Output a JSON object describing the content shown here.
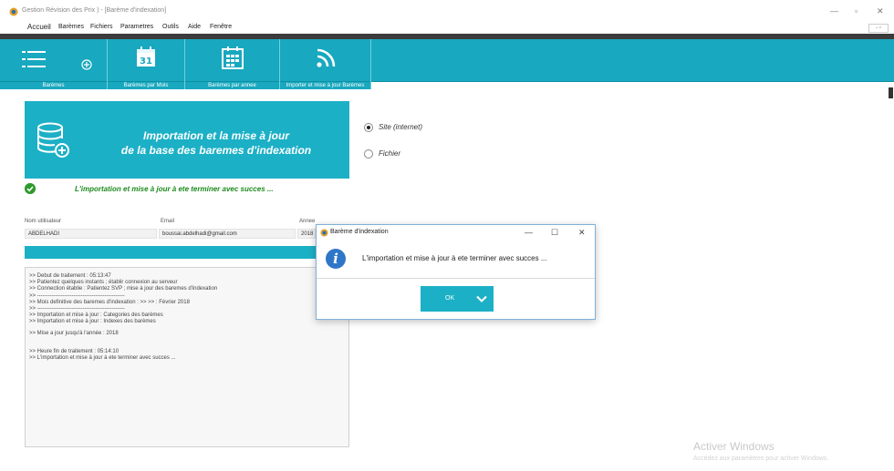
{
  "window": {
    "title": "Gestion Révision des Prix  ) - [Barème d'indexation]",
    "controls": [
      "—",
      "▫",
      "✕"
    ],
    "mdi_controls": "- ▫"
  },
  "menu": [
    "Accueil",
    "Barèmes",
    "Fichiers",
    "Parametres",
    "Outils",
    "Aide",
    "Fenêtre"
  ],
  "toolbar": {
    "calendar_number": "31",
    "buttons": [
      {
        "label": "Barèmes",
        "icon": "list-add-icon"
      },
      {
        "label": "Barèmes par Mois",
        "icon": "calendar-icon"
      },
      {
        "label": "Barèmes par annee",
        "icon": "calendar-grid-icon"
      },
      {
        "label": "Importer et mise à jour Barèmes",
        "icon": "rss-icon"
      }
    ]
  },
  "panel": {
    "title_line1": "Importation et la mise à jour",
    "title_line2": "de la base des baremes d'indexation",
    "icon": "database-add-icon"
  },
  "status": {
    "text": "L'importation et mise à jour  à ete  terminer  avec succes  ...",
    "icon": "check-circle-icon"
  },
  "source": {
    "options": [
      {
        "label": "Site (internet)",
        "checked": true
      },
      {
        "label": "Fichier",
        "checked": false
      }
    ]
  },
  "fields": {
    "user_label": "Nom utilisateur",
    "user_value": "ABDELHADI",
    "email_label": "Email",
    "email_value": "boussai.abdelhadi@gmail.com",
    "year_label": "Annee",
    "year_value": "2018"
  },
  "progress": {
    "percent": 100
  },
  "log": [
    ">>  Debut de traitement  :  05:13:47",
    ">>  Patientez quelques instants ; établir connexion au serveur",
    ">>  Connection établie : Patientez SVP ; mise à jour  des baremes d'indexation",
    ">>  ------------------------------------------------",
    ">>  Mois definitive des baremes d'indexation :  >> >>  :  Février 2018",
    ">>  ------------------------------------------------",
    ">>  Importation et mise à jour  :  Categories des barèmes",
    ">>  Importation et mise à jour  :  Indexes des barèmes",
    ">>  Mise a jour jusqu'à l'année  :  2018",
    ">>  Heure  fin  de traitement  :   05:14:10",
    ">>  L'importation et mise à jour  à ete  terminer  avec succes  ..."
  ],
  "watermark": {
    "title": "Activer Windows",
    "subtitle": "Accédez aux paramètres pour activer Windows."
  },
  "dialog": {
    "title": "Barème d'indexation",
    "message": "L'importation et mise à jour  à ete  terminer  avec succes  ...",
    "ok_label": "OK",
    "controls": [
      "—",
      "☐",
      "✕"
    ],
    "icon": "info-icon"
  },
  "colors": {
    "accent": "#1cb0c6",
    "success": "#1d8a1d",
    "info": "#2f76c8"
  }
}
